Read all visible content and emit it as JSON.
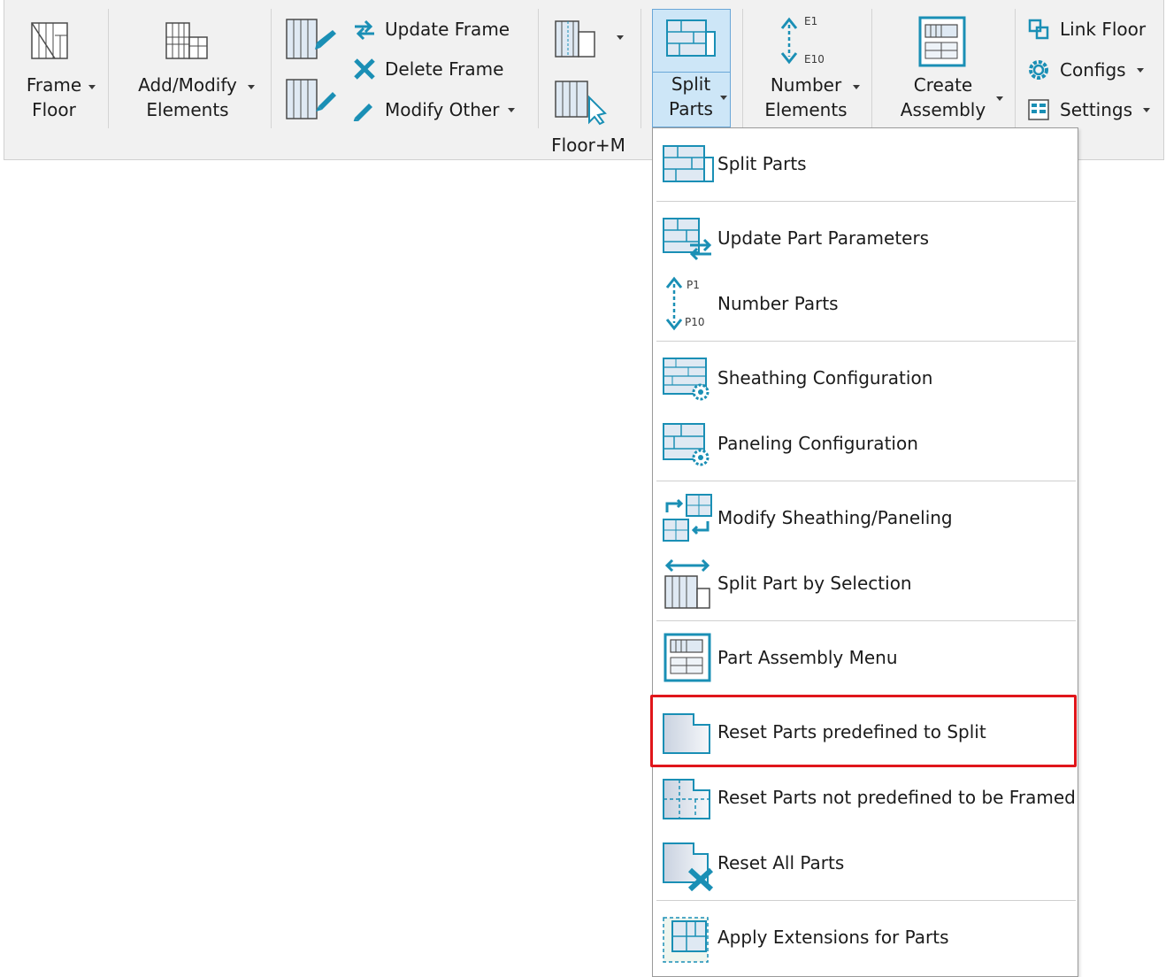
{
  "ribbon": {
    "frame_floor": {
      "line1": "Frame",
      "line2": "Floor"
    },
    "add_modify": {
      "line1": "Add/Modify",
      "line2": "Elements"
    },
    "update_frame": "Update Frame",
    "delete_frame": "Delete Frame",
    "modify_other": "Modify Other",
    "floor_m": "Floor+M",
    "split_parts": {
      "line1": "Split",
      "line2": "Parts"
    },
    "number_elements": {
      "line1": "Number",
      "line2": "Elements",
      "top": "E1",
      "bottom": "E10"
    },
    "create_assembly": {
      "line1": "Create",
      "line2": "Assembly"
    },
    "link_floor": "Link Floor",
    "configs": "Configs",
    "settings": "Settings"
  },
  "menu": {
    "split_parts": "Split Parts",
    "update_part_parameters": "Update Part Parameters",
    "number_parts": "Number Parts",
    "number_parts_top": "P1",
    "number_parts_bottom": "P10",
    "sheathing_configuration": "Sheathing Configuration",
    "paneling_configuration": "Paneling Configuration",
    "modify_sheathing_paneling": "Modify Sheathing/Paneling",
    "split_part_by_selection": "Split Part by Selection",
    "part_assembly_menu": "Part Assembly Menu",
    "reset_parts_predefined": "Reset Parts predefined to Split",
    "reset_parts_not_predefined": "Reset Parts not predefined to be Framed",
    "reset_all_parts": "Reset All Parts",
    "apply_extensions": "Apply Extensions for Parts"
  },
  "colors": {
    "accent": "#1a8fb5",
    "highlight": "#e0161b",
    "active_bg": "#cde6f7"
  }
}
